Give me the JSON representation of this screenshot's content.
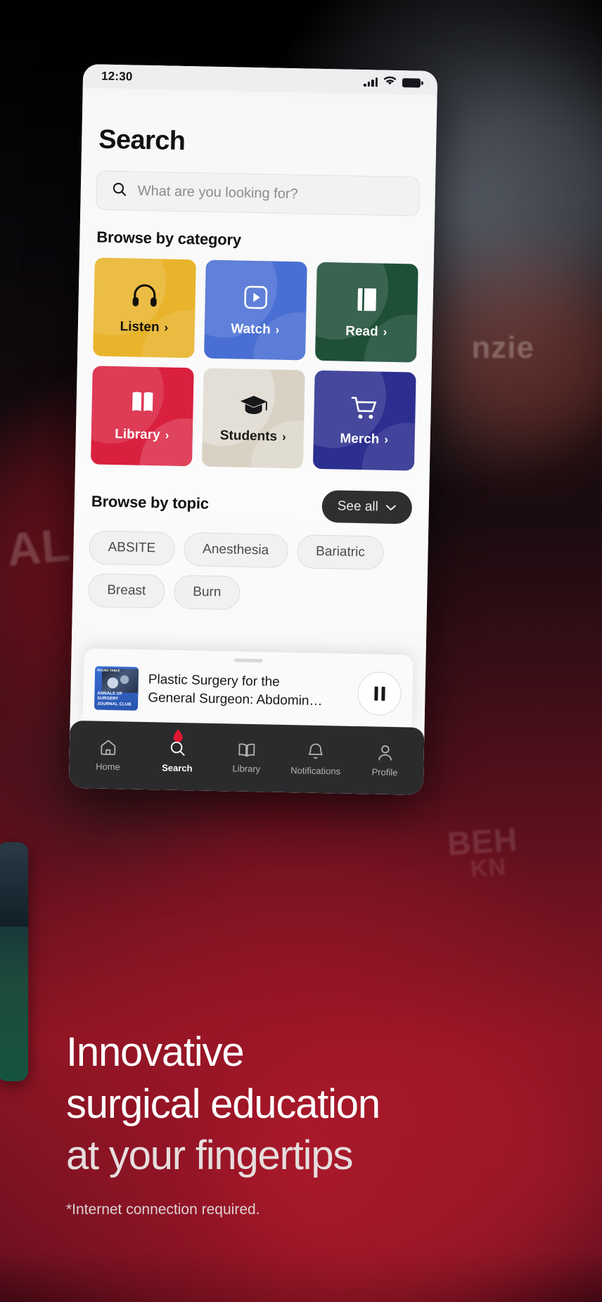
{
  "phone": {
    "status": {
      "time": "12:30",
      "signal_icon": "cellular-signal-icon",
      "wifi_icon": "wifi-icon",
      "battery_icon": "battery-full-icon"
    },
    "page_title": "Search",
    "search": {
      "placeholder": "What are you looking for?",
      "icon": "search-icon",
      "value": ""
    },
    "category_section": {
      "heading": "Browse by category"
    },
    "categories": [
      {
        "label": "Listen",
        "icon": "headphones-icon",
        "bg": "#e9b42c",
        "fg": "#14110a",
        "chevron": "›"
      },
      {
        "label": "Watch",
        "icon": "play-square-icon",
        "bg": "#4a6fd4",
        "fg": "#ffffff",
        "chevron": "›"
      },
      {
        "label": "Read",
        "icon": "book-closed-icon",
        "bg": "#1e5038",
        "fg": "#ffffff",
        "chevron": "›"
      },
      {
        "label": "Library",
        "icon": "open-book-icon",
        "bg": "#d9203f",
        "fg": "#ffffff",
        "chevron": "›"
      },
      {
        "label": "Students",
        "icon": "graduation-cap-icon",
        "bg": "#d9d2c4",
        "fg": "#1a1a18",
        "chevron": "›"
      },
      {
        "label": "Merch",
        "icon": "shopping-cart-icon",
        "bg": "#2c2f8f",
        "fg": "#ffffff",
        "chevron": "›"
      }
    ],
    "topic_section": {
      "heading": "Browse by topic",
      "see_all_label": "See all",
      "see_all_icon": "chevron-down-icon"
    },
    "topics": [
      "ABSITE",
      "Anesthesia",
      "Bariatric",
      "Breast",
      "Burn"
    ],
    "mini_player": {
      "artwork_tag": "ROUND TABLE",
      "artwork_caption": "ANNALS OF\nSURGERY\nJOURNAL CLUB",
      "artwork_line1": "ANNALS OF",
      "artwork_line2": "SURGERY",
      "artwork_line3": "JOURNAL CLUB",
      "title_line1": "Plastic Surgery for the",
      "title_line2": "General Surgeon: Abdomin…",
      "control_icon": "pause-icon"
    },
    "tabs": [
      {
        "label": "Home",
        "icon": "home-icon",
        "active": false
      },
      {
        "label": "Search",
        "icon": "search-icon",
        "active": true,
        "badge_icon": "blood-drop-icon"
      },
      {
        "label": "Library",
        "icon": "open-book-icon",
        "active": false
      },
      {
        "label": "Notifications",
        "icon": "bell-icon",
        "active": false
      },
      {
        "label": "Profile",
        "icon": "person-icon",
        "active": false
      }
    ]
  },
  "marketing": {
    "headline_line1": "Innovative",
    "headline_line2": "surgical education",
    "headline_line3": "at your fingertips",
    "footnote": "*Internet connection required."
  },
  "background": {
    "ghost_nzie": "nzie",
    "ghost_al": "AL",
    "ghost_beh": "BEH",
    "ghost_kn": "KN"
  },
  "colors": {
    "accent_red": "#d9203f",
    "tab_bar": "#2b2b2d",
    "see_all_bg": "#2f2f31"
  }
}
